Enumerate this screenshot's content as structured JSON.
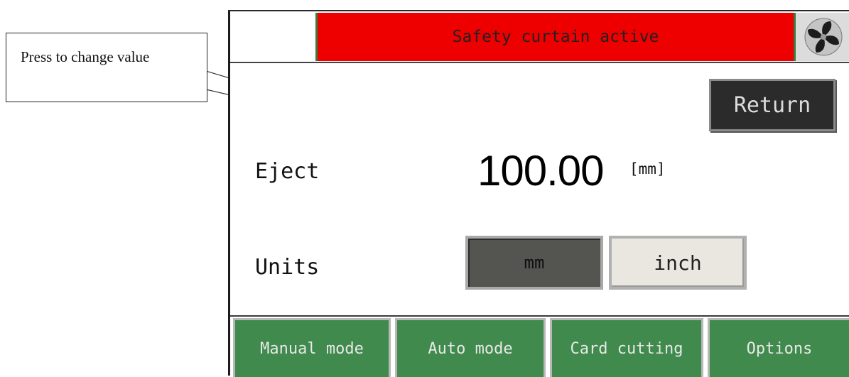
{
  "callout": {
    "text": "Press to change value"
  },
  "header": {
    "status_text": "Safety curtain active",
    "status_color": "#ee0000",
    "fan_icon": "fan-icon"
  },
  "return_button": {
    "label": "Return"
  },
  "eject": {
    "label": "Eject",
    "value": "100.00",
    "unit": "[mm]"
  },
  "units": {
    "label": "Units",
    "options": [
      "mm",
      "inch"
    ],
    "selected": "mm"
  },
  "nav": {
    "manual": "Manual mode",
    "auto": "Auto mode",
    "card_cutting": "Card cutting",
    "options": "Options"
  }
}
